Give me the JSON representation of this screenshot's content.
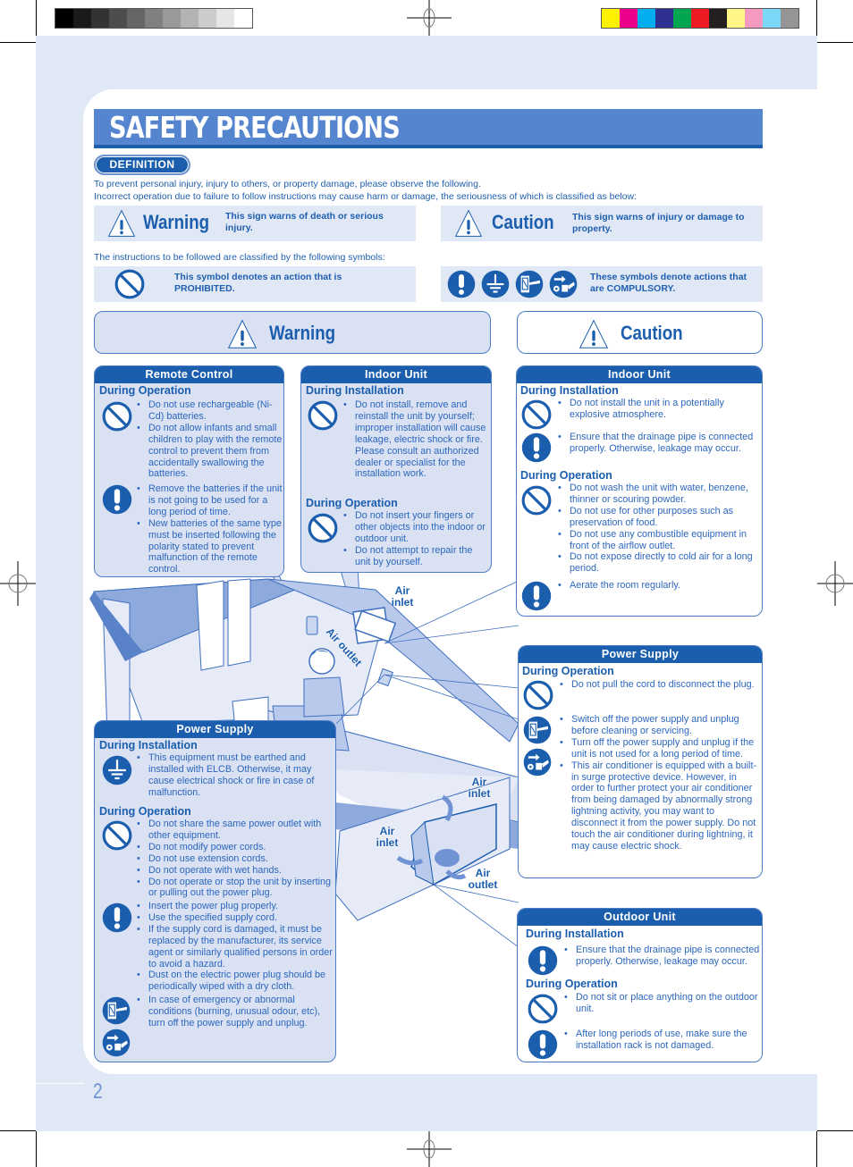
{
  "print_marks": {
    "gray_swatches": [
      "#000000",
      "#1a1a1a",
      "#333333",
      "#4d4d4d",
      "#666666",
      "#808080",
      "#999999",
      "#b3b3b3",
      "#cccccc",
      "#e6e6e6",
      "#ffffff"
    ],
    "color_swatches": [
      "#fff200",
      "#ec008c",
      "#00aeef",
      "#2e3192",
      "#00a651",
      "#ed1c24",
      "#231f20",
      "#fff685",
      "#f49ac1",
      "#7dd8f7",
      "#959595"
    ]
  },
  "colors": {
    "accent": "#1b5eae",
    "title_bar": "#5585cf",
    "page_bg": "#e1e8f5",
    "card_blue": "#d9e1f3",
    "text": "#1f5fb0"
  },
  "title": "SAFETY PRECAUTIONS",
  "definition": {
    "pill": "DEFINITION",
    "intro_line1": "To prevent personal injury, injury to others, or property damage, please observe the following.",
    "intro_line2": "Incorrect operation due to failure to follow instructions may cause harm or damage, the seriousness of which is classified as below:",
    "warning": {
      "label": "Warning",
      "desc": "This sign warns of death or serious injury.",
      "icon": "warning-triangle-icon"
    },
    "caution": {
      "label": "Caution",
      "desc": "This sign warns of injury or damage to property.",
      "icon": "warning-triangle-icon"
    },
    "symbols_intro": "The instructions to be followed are classified by the following symbols:",
    "prohibited": {
      "desc": "This symbol denotes an action that is PROHIBITED.",
      "icon": "prohibited-icon"
    },
    "compulsory": {
      "desc": "These symbols denote actions that are COMPULSORY.",
      "icons": [
        "exclamation-icon",
        "earth-ground-icon",
        "unplug-icon",
        "disconnect-power-icon"
      ]
    }
  },
  "warning_section": {
    "heading": "Warning",
    "remote_control": {
      "title": "Remote Control",
      "operation_heading": "During Operation",
      "prohibited": [
        "Do not use rechargeable (Ni-Cd) batteries.",
        "Do not allow infants and small children to play with the remote control to prevent them from accidentally swallowing the batteries."
      ],
      "compulsory": [
        "Remove the batteries if the unit is not going to be used for a long period of time.",
        "New batteries of the same type must be inserted following the polarity stated to prevent malfunction of the remote control."
      ]
    },
    "indoor_unit": {
      "title": "Indoor Unit",
      "installation_heading": "During Installation",
      "installation_prohibited": [
        "Do not install, remove and reinstall the unit by yourself; improper installation will cause leakage, electric shock or fire. Please consult an authorized dealer or specialist for the installation work."
      ],
      "operation_heading": "During Operation",
      "operation_prohibited": [
        "Do not insert your fingers or other objects into the indoor or outdoor unit.",
        "Do not attempt to repair the unit by yourself."
      ]
    },
    "power_supply": {
      "title": "Power Supply",
      "installation_heading": "During Installation",
      "installation_earth": [
        "This equipment must be earthed and installed with ELCB. Otherwise, it may cause electrical shock or fire in case of malfunction."
      ],
      "operation_heading": "During Operation",
      "operation_prohibited": [
        "Do not share the same power outlet with other equipment.",
        "Do not modify power cords.",
        "Do not use extension cords.",
        "Do not operate with wet hands.",
        "Do not operate or stop the unit by inserting or pulling out the power plug."
      ],
      "operation_compulsory": [
        "Insert the power plug properly.",
        "Use the specified supply cord.",
        "If the supply cord is damaged, it must be replaced by the manufacturer, its service agent or similarly qualified persons in order to avoid a hazard.",
        "Dust on the electric power plug should be periodically wiped with a dry cloth."
      ],
      "operation_unplug": [
        "In case of emergency or abnormal conditions (burning, unusual odour, etc), turn off the power supply and unplug."
      ]
    }
  },
  "caution_section": {
    "heading": "Caution",
    "indoor_unit": {
      "title": "Indoor Unit",
      "installation_heading": "During Installation",
      "installation_prohibited": [
        "Do not install the unit in a potentially explosive atmosphere."
      ],
      "installation_compulsory": [
        "Ensure that the drainage pipe is connected properly. Otherwise, leakage may occur."
      ],
      "operation_heading": "During Operation",
      "operation_prohibited": [
        "Do not wash the unit with water, benzene, thinner or scouring powder.",
        "Do not use for other purposes such as preservation of food.",
        "Do not use any combustible equipment in front of the airflow outlet.",
        "Do not expose directly to cold air for a long period."
      ],
      "operation_compulsory": [
        "Aerate the room regularly."
      ]
    },
    "power_supply": {
      "title": "Power Supply",
      "operation_heading": "During Operation",
      "operation_prohibited": [
        "Do not pull the cord to disconnect the plug."
      ],
      "operation_unplug": [
        "Switch off the power supply and unplug before cleaning or servicing.",
        "Turn off the power supply and unplug if the unit is not used for a long period of time.",
        "This air conditioner is equipped with a built-in surge protective device. However, in order to further protect your air conditioner from being damaged by abnormally strong lightning activity, you may want to disconnect it from the power supply. Do not touch the air conditioner during lightning, it may cause electric shock."
      ]
    },
    "outdoor_unit": {
      "title": "Outdoor Unit",
      "installation_heading": "During Installation",
      "installation_compulsory": [
        "Ensure that the drainage pipe is connected properly. Otherwise, leakage may occur."
      ],
      "operation_heading": "During Operation",
      "operation_prohibited": [
        "Do not sit or place anything on the outdoor unit."
      ],
      "operation_compulsory": [
        "After long periods of use, make sure the installation rack is not damaged."
      ]
    }
  },
  "illustration": {
    "indoor_air_inlet": "Air inlet",
    "indoor_air_outlet": "Air outlet",
    "outdoor_air_inlet_top": "Air inlet",
    "outdoor_air_inlet_side": "Air inlet",
    "outdoor_air_outlet": "Air outlet"
  },
  "page_number": "2"
}
